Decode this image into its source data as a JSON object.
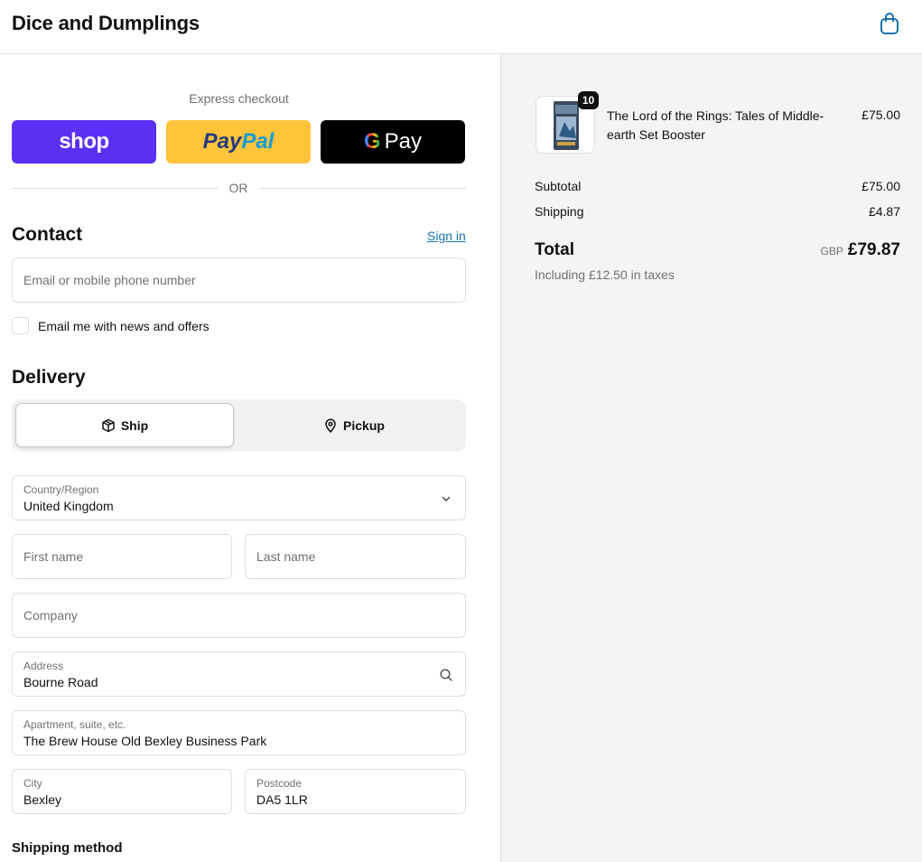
{
  "header": {
    "brand": "Dice and Dumplings",
    "cart_icon": "shopping-bag-icon"
  },
  "express": {
    "label": "Express checkout",
    "shop_label": "shop",
    "paypal_label_1": "Pay",
    "paypal_label_2": "Pal",
    "gpay_g": "G",
    "gpay_label": "Pay",
    "or_label": "OR",
    "colors": {
      "shop": "#5a31f4",
      "paypal": "#ffc439",
      "gpay": "#000000"
    }
  },
  "contact": {
    "title": "Contact",
    "signin_label": "Sign in",
    "email_placeholder": "Email or mobile phone number",
    "newsletter_label": "Email me with news and offers",
    "newsletter_checked": false
  },
  "delivery": {
    "title": "Delivery",
    "options": [
      {
        "label": "Ship",
        "icon": "package-icon",
        "selected": true
      },
      {
        "label": "Pickup",
        "icon": "location-pin-icon",
        "selected": false
      }
    ],
    "country": {
      "label": "Country/Region",
      "value": "United Kingdom"
    },
    "first_name_placeholder": "First name",
    "last_name_placeholder": "Last name",
    "company_placeholder": "Company",
    "address": {
      "label": "Address",
      "value": "Bourne Road"
    },
    "apartment": {
      "label": "Apartment, suite, etc.",
      "value": "The Brew House Old Bexley Business Park"
    },
    "city": {
      "label": "City",
      "value": "Bexley"
    },
    "postcode": {
      "label": "Postcode",
      "value": "DA5 1LR"
    },
    "shipping_method_title": "Shipping method"
  },
  "summary": {
    "item": {
      "quantity": "10",
      "name": "The Lord of the Rings: Tales of Middle-earth Set Booster",
      "price": "£75.00"
    },
    "subtotal_label": "Subtotal",
    "subtotal": "£75.00",
    "shipping_label": "Shipping",
    "shipping": "£4.87",
    "total_label": "Total",
    "currency": "GBP",
    "total": "£79.87",
    "tax_note": "Including £12.50 in taxes"
  }
}
